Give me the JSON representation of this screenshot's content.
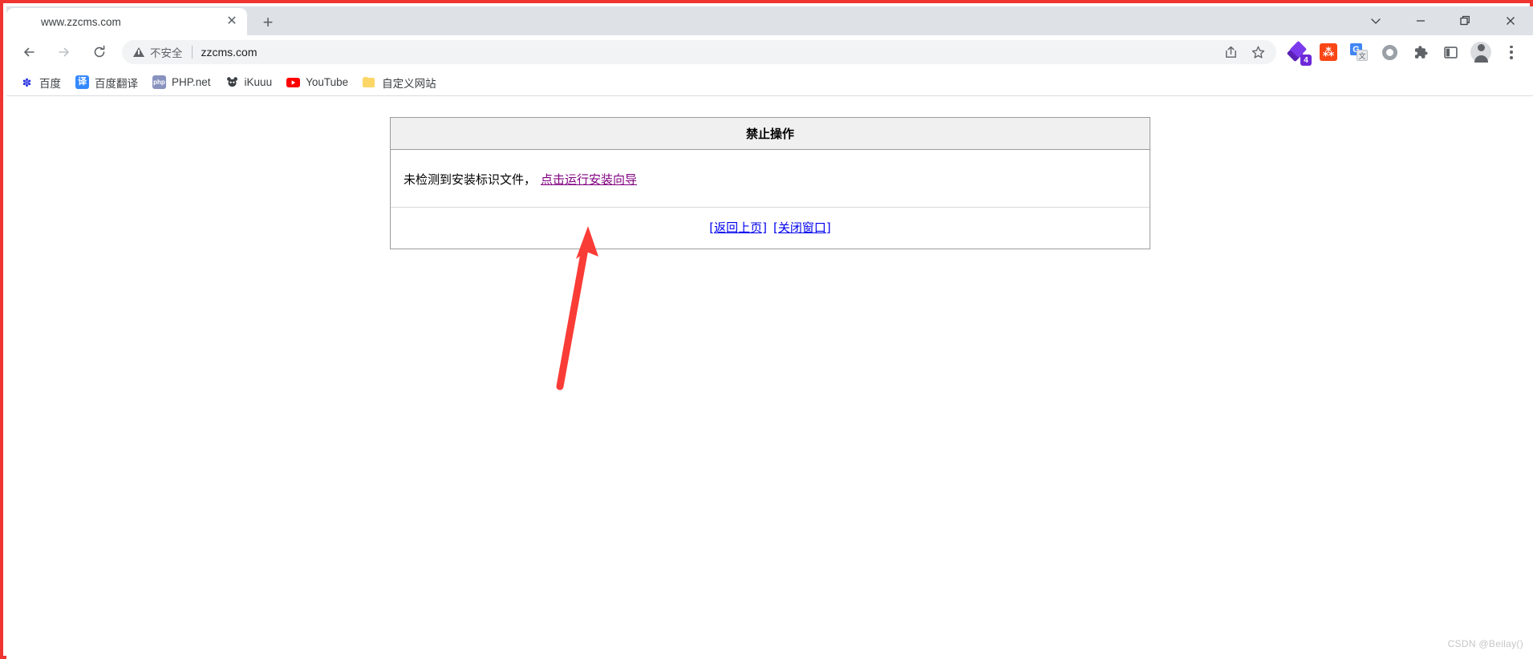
{
  "window": {
    "controls": [
      {
        "name": "tab-search-button",
        "label": "⌄",
        "title": "Search tabs"
      },
      {
        "name": "minimize-button",
        "label": "—",
        "title": "Minimize"
      },
      {
        "name": "maximize-button",
        "label": "❐",
        "title": "Restore"
      },
      {
        "name": "close-button",
        "label": "✕",
        "title": "Close"
      }
    ]
  },
  "tabs": [
    {
      "title": "www.zzcms.com",
      "favicon": "globe-icon",
      "close_label": "✕",
      "active": true
    }
  ],
  "new_tab": {
    "label": "+"
  },
  "toolbar": {
    "back_label": "←",
    "forward_label": "→",
    "reload_label": "⟳",
    "security": {
      "icon": "warning-triangle-icon",
      "text": "不安全",
      "divider": "|"
    },
    "url": "zzcms.com",
    "omnibox_icons": [
      {
        "name": "share-icon",
        "glyph": "↗"
      },
      {
        "name": "bookmark-star-icon",
        "glyph": "☆"
      }
    ],
    "extensions": [
      {
        "name": "layers-extension-icon",
        "badge": "4",
        "color": "#6d28d9"
      },
      {
        "name": "orange-extension-icon",
        "glyph": "⁂",
        "color": "#fa4616"
      },
      {
        "name": "google-translate-icon",
        "glyph": "G",
        "sub_glyph": "文",
        "color": "#4285f4"
      },
      {
        "name": "ring-extension-icon",
        "color": "#9aa0a6"
      },
      {
        "name": "extensions-puzzle-icon",
        "color": "#5f6368"
      },
      {
        "name": "side-panel-icon",
        "color": "#5f6368"
      }
    ],
    "profile": {
      "name": "profile-avatar",
      "label": ""
    },
    "menu": {
      "name": "chrome-menu-icon",
      "label": "⋮"
    }
  },
  "bookmarks": [
    {
      "label": "百度",
      "icon": "baidu-paw-icon",
      "icon_glyph": "✽",
      "icon_class": "ico-baidu"
    },
    {
      "label": "百度翻译",
      "icon": "baidu-translate-icon",
      "icon_glyph": "译",
      "icon_class": "ico-fanyi"
    },
    {
      "label": "PHP.net",
      "icon": "php-icon",
      "icon_glyph": "php",
      "icon_class": "ico-php"
    },
    {
      "label": "iKuuu",
      "icon": "ikuuu-icon",
      "icon_glyph": "●",
      "icon_class": "ico-ikuuu"
    },
    {
      "label": "YouTube",
      "icon": "youtube-icon",
      "icon_glyph": "▶",
      "icon_class": "ico-yt"
    },
    {
      "label": "自定义网站",
      "icon": "folder-icon",
      "icon_glyph": "",
      "icon_class": "ico-folder"
    }
  ],
  "page": {
    "message_box": {
      "title": "禁止操作",
      "body_text": "未检测到安装标识文件，",
      "install_link": "点击运行安装向导",
      "footer_links": [
        {
          "label": "[返回上页]",
          "name": "back-link"
        },
        {
          "label": "[关闭窗口]",
          "name": "close-window-link"
        }
      ]
    },
    "annotation": {
      "name": "red-arrow-annotation",
      "color": "#fa3c37"
    },
    "watermark": "CSDN @Beilay()"
  },
  "colors": {
    "frame_red": "#f0342f",
    "tab_strip": "#dee1e6",
    "omnibox_bg": "#f1f3f4",
    "dialog_header": "#f0f0f0",
    "dialog_border": "#9b9b9b",
    "link_blue": "#0000ee",
    "link_visited": "#800080",
    "arrow_red": "#fa3c37"
  }
}
